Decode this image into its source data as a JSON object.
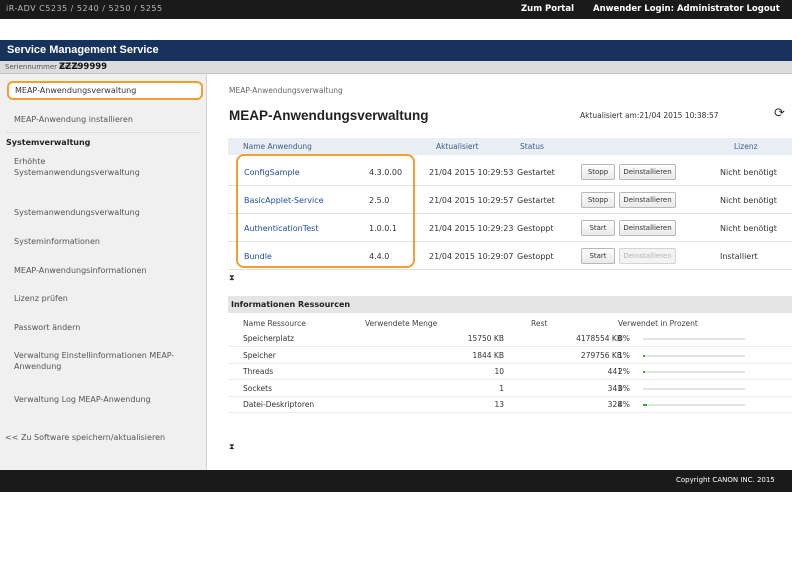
{
  "topbar": {
    "brand": "iR-ADV C5235 / 5240 / 5250 / 5255",
    "portal": "Zum Portal",
    "user": "Anwender Login: Administrator",
    "logout": "Logout"
  },
  "app_title": "Service Management Service",
  "serial": {
    "label": "Seriennummer Gerät",
    "value": "ZZZ99999"
  },
  "sidebar": {
    "active_item": "MEAP-Anwendungsverwaltung",
    "install": "MEAP-Anwendung installieren",
    "section_header": "Systemverwaltung",
    "items": [
      "Erhöhte Systemanwendungsverwaltung",
      "Systemanwendungsverwaltung",
      "Systeminformationen",
      "MEAP-Anwendungsinformationen",
      "Lizenz prüfen",
      "Passwort ändern",
      "Verwaltung Einstellinformationen MEAP-Anwendung",
      "Verwaltung Log MEAP-Anwendung"
    ],
    "back_link": "<< Zu Software speichern/aktualisieren"
  },
  "main": {
    "breadcrumb": "MEAP-Anwendungsverwaltung",
    "title": "MEAP-Anwendungsverwaltung",
    "updated": "Aktualisiert am:21/04 2015 10:38:57",
    "refresh_icon": "refresh-icon"
  },
  "apps_table": {
    "headers": [
      "Name Anwendung",
      "Aktualisiert",
      "Status",
      "Lizenz"
    ],
    "rows": [
      {
        "name": "ConfigSample",
        "version": "4.3.0.00",
        "date": "21/04 2015 10:29:53",
        "status": "Gestartet",
        "btn_a": "Stopp",
        "btn_b": "Deinstallieren",
        "btn_b_disabled": false,
        "license": "Nicht benötigt"
      },
      {
        "name": "BasicApplet-Service",
        "version": "2.5.0",
        "date": "21/04 2015 10:29:57",
        "status": "Gestartet",
        "btn_a": "Stopp",
        "btn_b": "Deinstallieren",
        "btn_b_disabled": false,
        "license": "Nicht benötigt"
      },
      {
        "name": "AuthenticationTest",
        "version": "1.0.0.1",
        "date": "21/04 2015 10:29:23",
        "status": "Gestoppt",
        "btn_a": "Start",
        "btn_b": "Deinstallieren",
        "btn_b_disabled": false,
        "license": "Nicht benötigt"
      },
      {
        "name": "Bundle",
        "version": "4.4.0",
        "date": "21/04 2015 10:29:07",
        "status": "Gestoppt",
        "btn_a": "Start",
        "btn_b": "Deinstallieren",
        "btn_b_disabled": true,
        "license": "Installiert"
      }
    ]
  },
  "hourglass_icon": "⧗",
  "resources": {
    "title": "Informationen Ressourcen",
    "headers": [
      "Name Ressource",
      "Verwendete Menge",
      "Rest",
      "Verwendet in Prozent"
    ],
    "rows": [
      {
        "name": "Speicherplatz",
        "used": "15750 KB",
        "rest": "4178554 KB",
        "pct": "0%",
        "fraction": 0.0
      },
      {
        "name": "Speicher",
        "used": "1844 KB",
        "rest": "279756 KB",
        "pct": "1%",
        "fraction": 0.01
      },
      {
        "name": "Threads",
        "used": "10",
        "rest": "441",
        "pct": "2%",
        "fraction": 0.02
      },
      {
        "name": "Sockets",
        "used": "1",
        "rest": "343",
        "pct": "0%",
        "fraction": 0.0
      },
      {
        "name": "Datei-Deskriptoren",
        "used": "13",
        "rest": "328",
        "pct": "4%",
        "fraction": 0.04
      }
    ]
  },
  "footer": "Copyright CANON INC. 2015",
  "colors": {
    "accent": "#f0a030",
    "titlebar": "#17325c",
    "bar_fill": "#3aa63a"
  }
}
